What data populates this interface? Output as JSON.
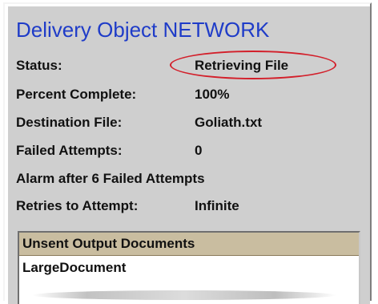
{
  "title": "Delivery Object NETWORK",
  "fields": [
    {
      "label": "Status:",
      "value": "Retrieving File"
    },
    {
      "label": "Percent Complete:",
      "value": "100%"
    },
    {
      "label": "Destination File:",
      "value": "Goliath.txt"
    },
    {
      "label": "Failed Attempts:",
      "value": "0"
    },
    {
      "label": "Alarm after 6 Failed Attempts",
      "value": ""
    },
    {
      "label": "Retries to Attempt:",
      "value": "Infinite"
    }
  ],
  "list": {
    "header": "Unsent Output Documents",
    "items": [
      "LargeDocument"
    ]
  },
  "colors": {
    "title": "#1f3cc8",
    "highlight_ellipse": "#d31f2a",
    "panel": "#cfcfcf",
    "list_header": "#c9bda0"
  }
}
